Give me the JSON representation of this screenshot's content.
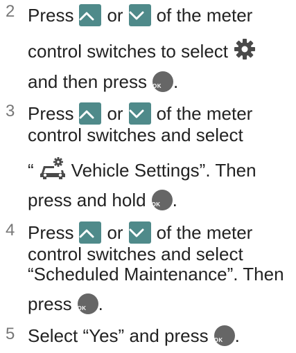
{
  "steps": [
    {
      "number": "2",
      "lines": [
        [
          "Press",
          "or",
          "of the meter"
        ],
        [
          "control switches to select"
        ],
        [
          "and then press",
          "."
        ]
      ]
    },
    {
      "number": "3",
      "lines": [
        [
          "Press",
          "or",
          "of the meter"
        ],
        [
          "control switches and select"
        ],
        [
          "“",
          "Vehicle Settings”. Then"
        ],
        [
          "press and hold",
          "."
        ]
      ]
    },
    {
      "number": "4",
      "lines": [
        [
          "Press",
          "or",
          "of the meter"
        ],
        [
          "control switches and select"
        ],
        [
          "“Scheduled Maintenance”. Then"
        ],
        [
          "press",
          "."
        ]
      ]
    },
    {
      "number": "5",
      "lines": [
        [
          "Select “Yes” and press",
          "."
        ]
      ]
    }
  ],
  "ok_button_label": "OK",
  "icons": {
    "up": "chevron-up-icon",
    "down": "chevron-down-icon",
    "gear": "gear-icon",
    "car_gear": "car-settings-icon",
    "ok": "ok-button-icon"
  },
  "colors": {
    "arrow_button": "#4f8a8a",
    "ok_button": "#666666",
    "step_number": "#777777",
    "text": "#222222"
  }
}
